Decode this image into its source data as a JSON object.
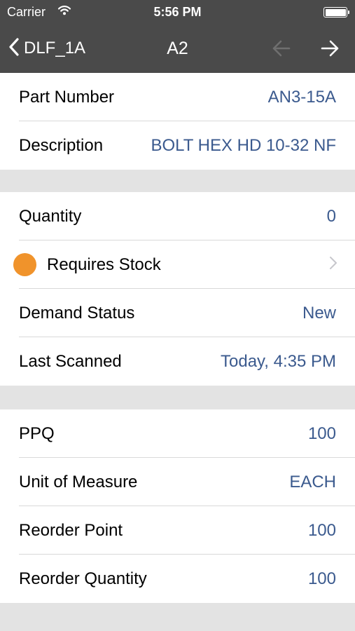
{
  "status_bar": {
    "carrier": "Carrier",
    "time": "5:56 PM",
    "wifi_icon": "wifi-icon",
    "battery_icon": "battery-icon"
  },
  "nav": {
    "back_label": "DLF_1A",
    "title": "A2",
    "prev_icon": "arrow-left-icon",
    "next_icon": "arrow-right-icon",
    "prev_enabled": false,
    "next_enabled": true
  },
  "part": {
    "part_number_label": "Part Number",
    "part_number": "AN3-15A",
    "description_label": "Description",
    "description": "BOLT HEX HD 10-32 NF"
  },
  "status": {
    "quantity_label": "Quantity",
    "quantity": "0",
    "requires_stock_label": "Requires Stock",
    "demand_status_label": "Demand Status",
    "demand_status": "New",
    "last_scanned_label": "Last Scanned",
    "last_scanned": "Today, 4:35 PM"
  },
  "stock": {
    "ppq_label": "PPQ",
    "ppq": "100",
    "uom_label": "Unit of Measure",
    "uom": "EACH",
    "reorder_point_label": "Reorder Point",
    "reorder_point": "100",
    "reorder_quantity_label": "Reorder Quantity",
    "reorder_quantity": "100"
  },
  "colors": {
    "bar_background": "#4a4a4a",
    "value_text": "#3b5a8e",
    "status_dot": "#f0932b",
    "group_gap": "#e3e3e3",
    "chevron": "#c7c7cc"
  }
}
